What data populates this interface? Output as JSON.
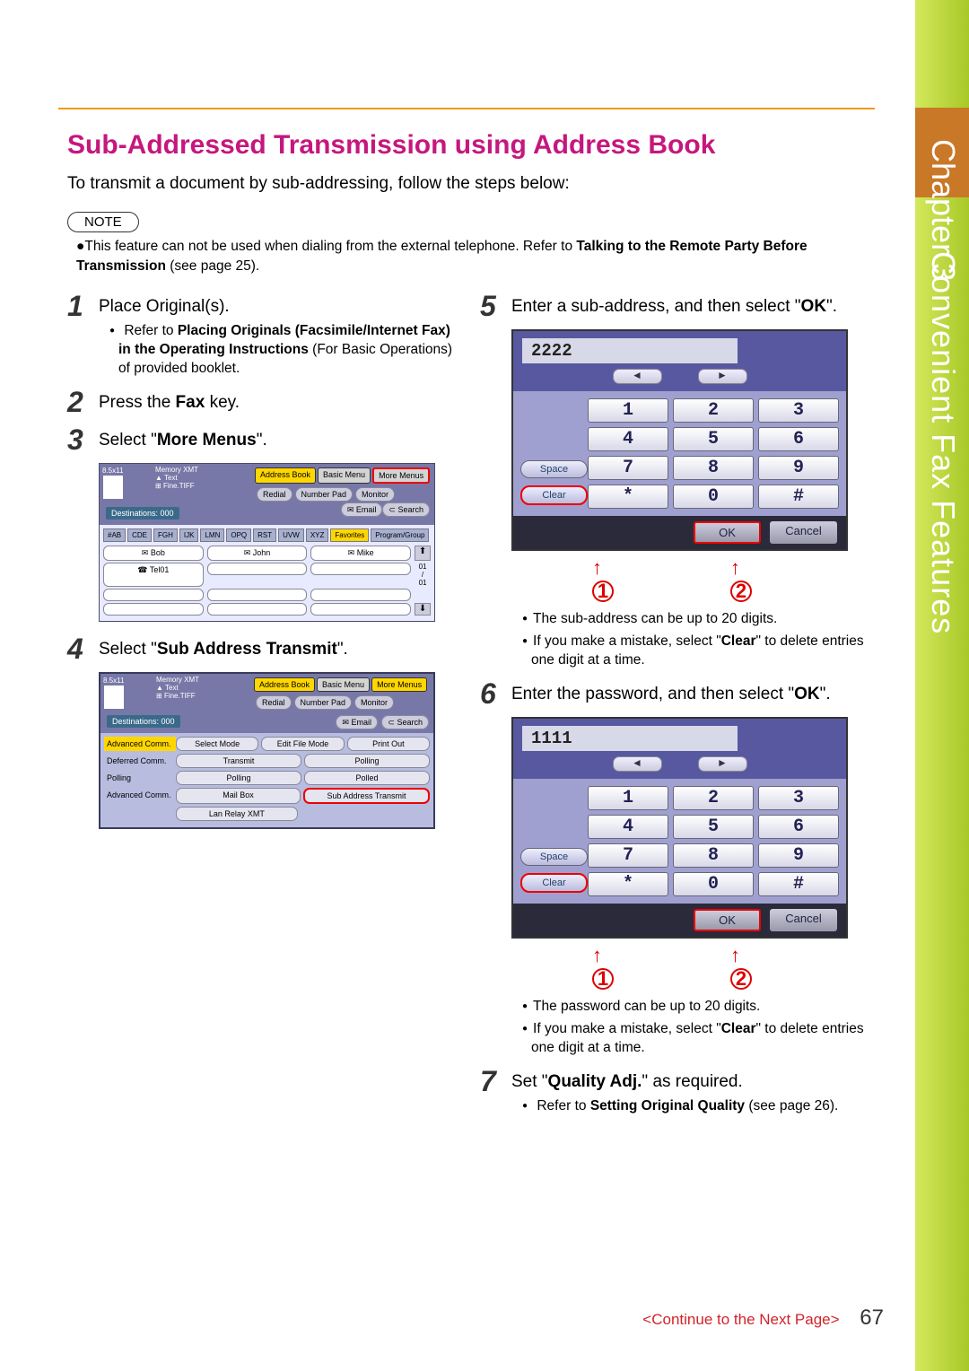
{
  "sideTab": {
    "chapter": "Chapter 3",
    "title": "Convenient Fax Features"
  },
  "heading": "Sub-Addressed Transmission using Address Book",
  "intro": "To transmit a document by sub-addressing, follow the steps below:",
  "noteLabel": "NOTE",
  "noteText": [
    "This feature can not be used when dialing from the external telephone. Refer to ",
    "Talking to the Remote Party Before Transmission",
    " (see page 25)."
  ],
  "steps": {
    "s1": {
      "num": "1",
      "text": "Place Original(s).",
      "sub": [
        "Refer to ",
        "Placing Originals (Facsimile/Internet Fax) in the Operating Instructions",
        " (For Basic Operations) of provided booklet."
      ]
    },
    "s2": {
      "num": "2",
      "text_a": "Press the ",
      "text_b": "Fax",
      "text_c": " key."
    },
    "s3": {
      "num": "3",
      "text_a": "Select \"",
      "text_b": "More Menus",
      "text_c": "\"."
    },
    "s4": {
      "num": "4",
      "text_a": "Select \"",
      "text_b": "Sub Address Transmit",
      "text_c": "\"."
    },
    "s5": {
      "num": "5",
      "text_a": "Enter a sub-address, and then select \"",
      "text_b": "OK",
      "text_c": "\"."
    },
    "s5notes": [
      "The sub-address can be up to 20 digits.",
      "If you make a mistake, select \"Clear\" to delete entries one digit at a time."
    ],
    "s6": {
      "num": "6",
      "text_a": "Enter the password, and then select \"",
      "text_b": "OK",
      "text_c": "\"."
    },
    "s6notes": [
      "The password can be up to 20 digits.",
      "If you make a mistake, select \"Clear\" to delete entries one digit at a time."
    ],
    "s7": {
      "num": "7",
      "text_a": "Set \"",
      "text_b": "Quality Adj.",
      "text_c": "\" as required.",
      "sub": [
        "Refer to ",
        "Setting Original Quality",
        " (see page 26)."
      ]
    }
  },
  "screenshot3": {
    "size": "8.5x11",
    "memory": "Memory XMT",
    "text": "Text",
    "fine": "Fine.TIFF",
    "tabs": [
      "Address Book",
      "Basic Menu",
      "More Menus"
    ],
    "row2": [
      "Redial",
      "Number Pad",
      "Monitor"
    ],
    "dest": "Destinations: 000",
    "row3": [
      "Email",
      "Search"
    ],
    "alpha": [
      "#AB",
      "CDE",
      "FGH",
      "IJK",
      "LMN",
      "OPQ",
      "RST",
      "UVW",
      "XYZ",
      "Favorites",
      "Program/Group"
    ],
    "contacts": [
      "Bob",
      "John",
      "Mike",
      "Tel01"
    ]
  },
  "screenshot4": {
    "tabs": [
      "Address Book",
      "Basic Menu",
      "More Menus"
    ],
    "row2": [
      "Redial",
      "Number Pad",
      "Monitor"
    ],
    "row3": [
      "Email",
      "Search"
    ],
    "dest": "Destinations: 000",
    "rows": [
      {
        "label": "Advanced Comm.",
        "btns": [
          "Select Mode",
          "Edit File Mode",
          "Print Out"
        ]
      },
      {
        "label": "Deferred Comm.",
        "btns": [
          "Transmit",
          "Polling"
        ]
      },
      {
        "label": "Polling",
        "btns": [
          "Polling",
          "Polled"
        ]
      },
      {
        "label": "Advanced Comm.",
        "btns": [
          "Mail Box",
          "Sub Address Transmit"
        ]
      },
      {
        "label": "",
        "btns": [
          "Lan Relay XMT"
        ]
      }
    ]
  },
  "keypad5": {
    "display": "2222",
    "keys": [
      "1",
      "2",
      "3",
      "4",
      "5",
      "6",
      "7",
      "8",
      "9",
      "*",
      "0",
      "#"
    ],
    "space": "Space",
    "clear": "Clear",
    "ok": "OK",
    "cancel": "Cancel"
  },
  "keypad6": {
    "display": "1111",
    "keys": [
      "1",
      "2",
      "3",
      "4",
      "5",
      "6",
      "7",
      "8",
      "9",
      "*",
      "0",
      "#"
    ],
    "space": "Space",
    "clear": "Clear",
    "ok": "OK",
    "cancel": "Cancel"
  },
  "callouts": {
    "c1": "1",
    "c2": "2"
  },
  "footer": {
    "text": "<Continue to the Next Page>",
    "page": "67"
  }
}
